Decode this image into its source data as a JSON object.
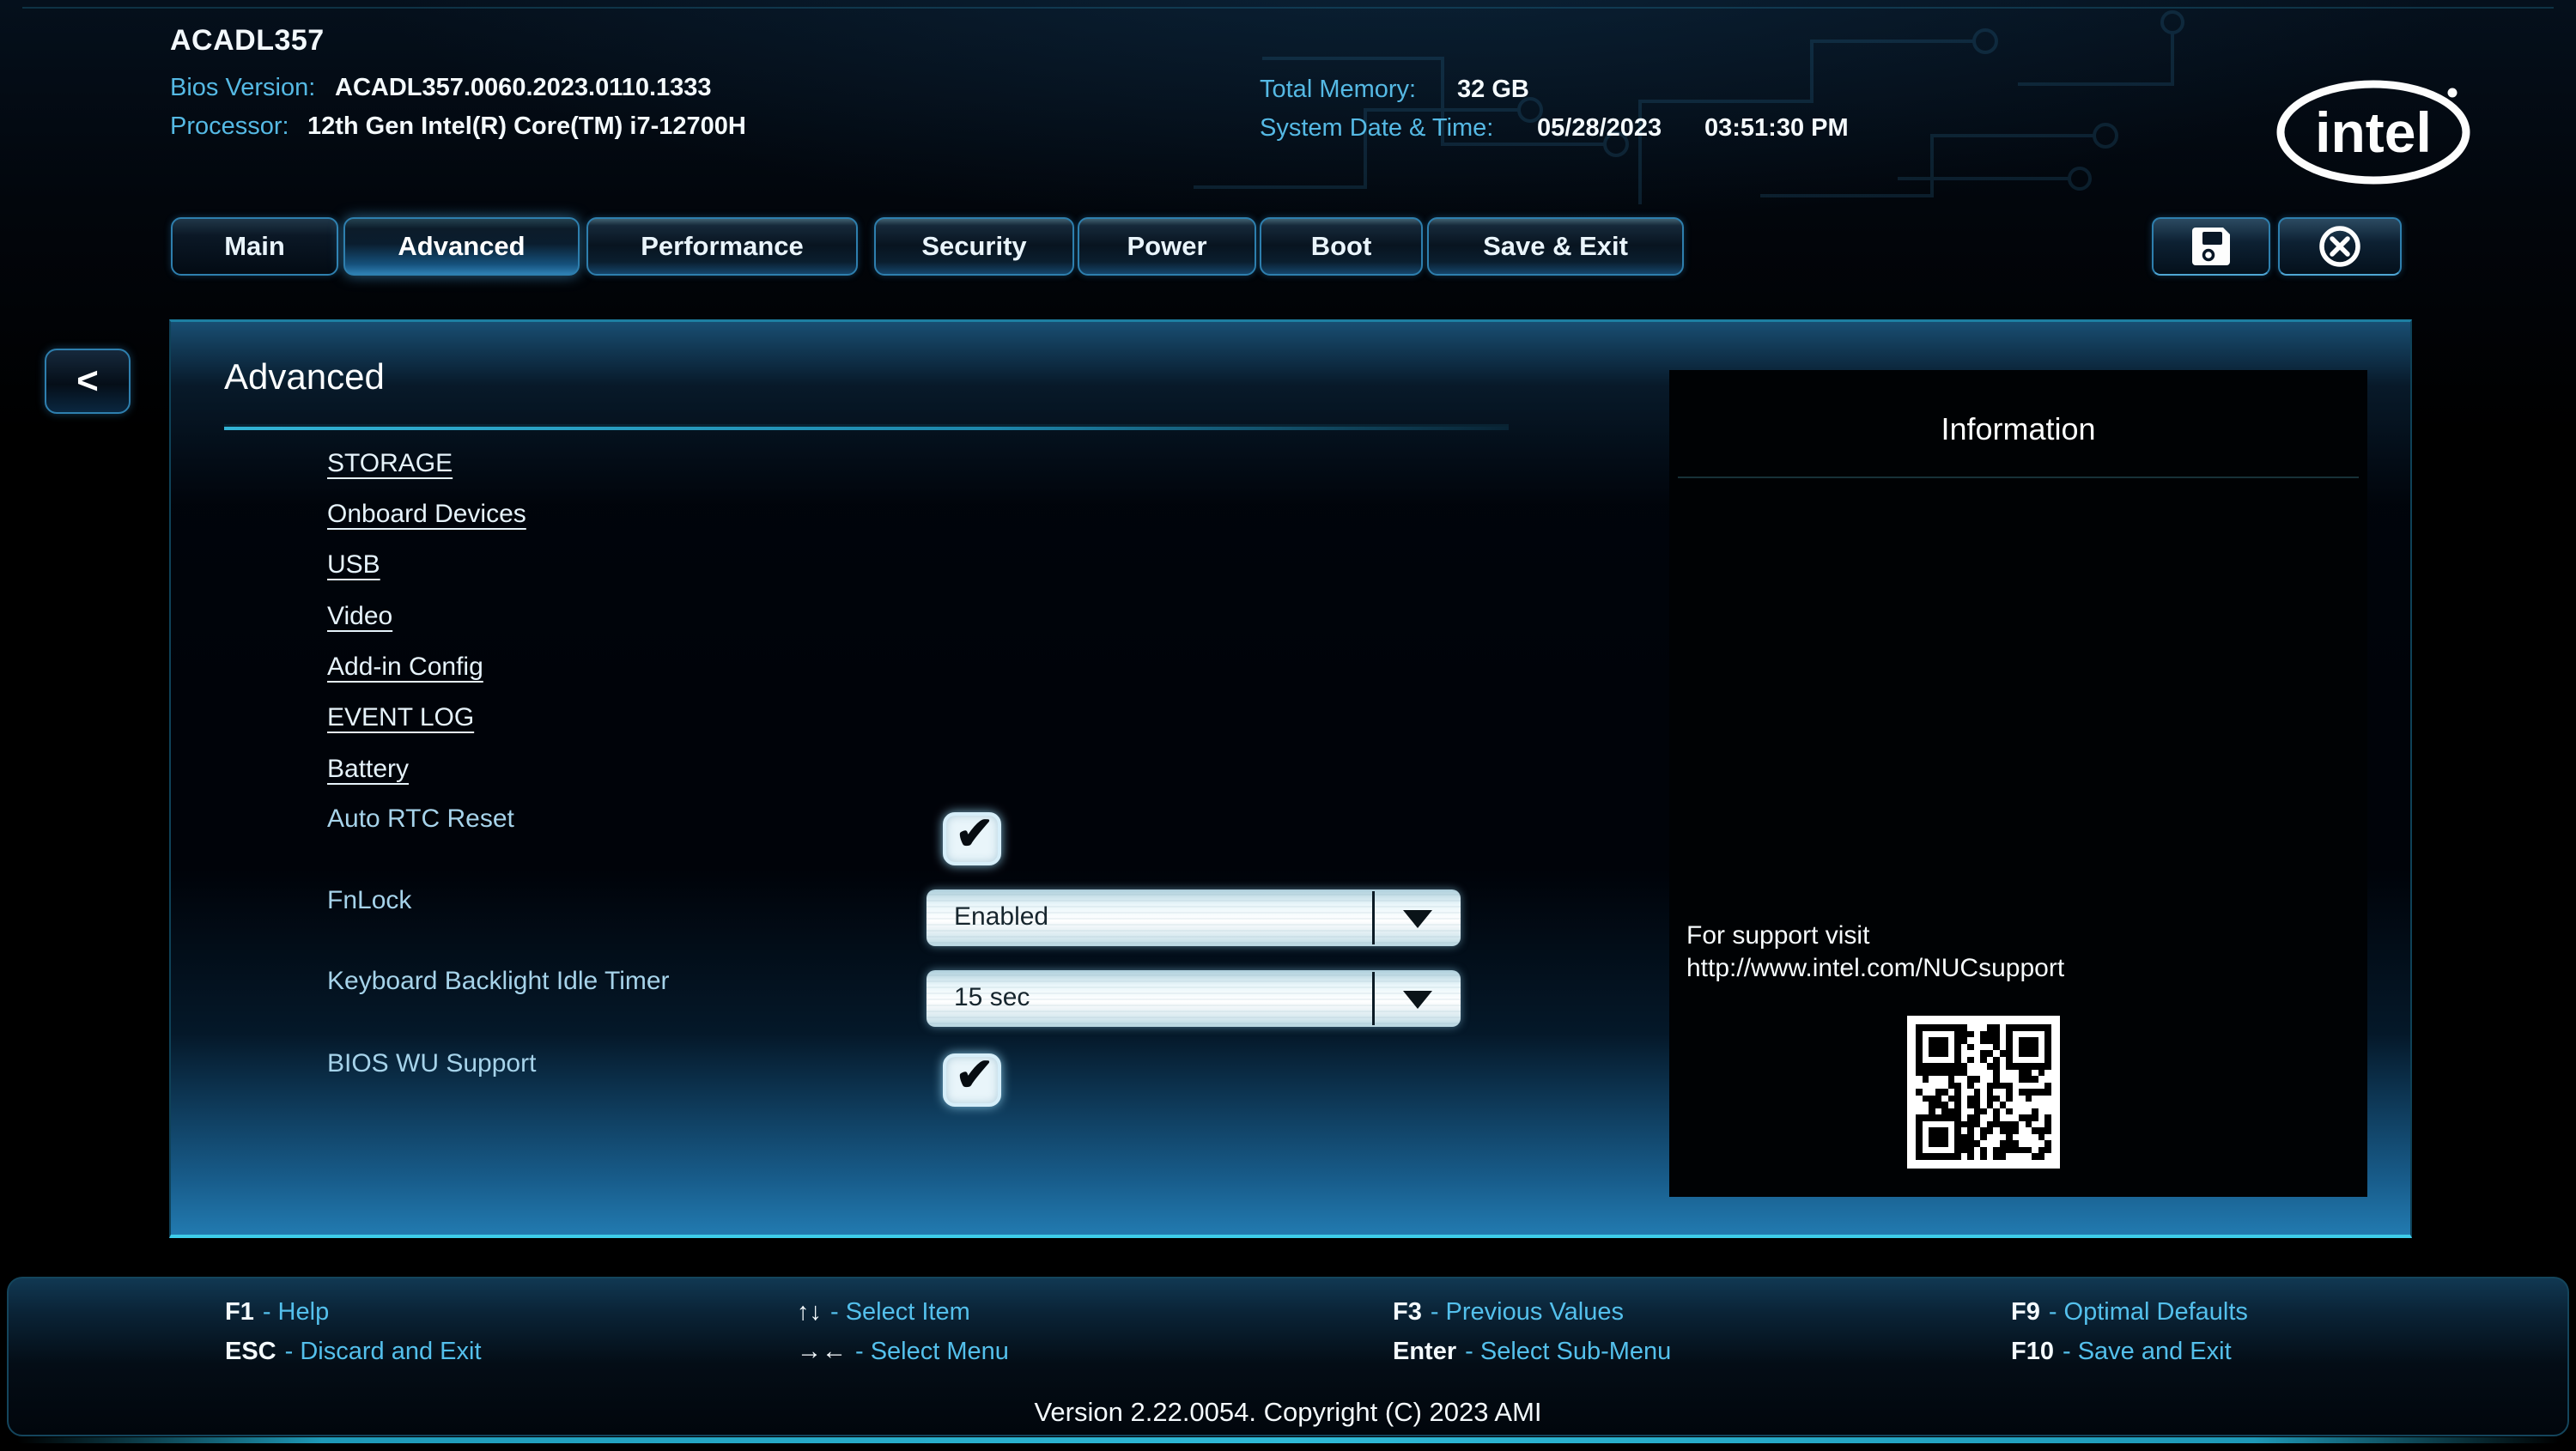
{
  "header": {
    "model": "ACADL357",
    "bios_version_label": "Bios Version:",
    "bios_version": "ACADL357.0060.2023.0110.1333",
    "processor_label": "Processor:",
    "processor": "12th Gen Intel(R) Core(TM) i7-12700H",
    "total_memory_label": "Total Memory:",
    "total_memory": "32 GB",
    "datetime_label": "System Date & Time:",
    "date": "05/28/2023",
    "time": "03:51:30 PM",
    "logo_text": "intel"
  },
  "tabs": [
    {
      "label": "Main",
      "active": false
    },
    {
      "label": "Advanced",
      "active": true
    },
    {
      "label": "Performance",
      "active": false
    },
    {
      "label": "Security",
      "active": false
    },
    {
      "label": "Power",
      "active": false
    },
    {
      "label": "Boot",
      "active": false
    },
    {
      "label": "Save & Exit",
      "active": false
    }
  ],
  "toolbar": {
    "save_icon": "floppy-disk",
    "close_icon": "circle-x"
  },
  "back_button": {
    "label": "<"
  },
  "page": {
    "title": "Advanced",
    "links": [
      "STORAGE",
      "Onboard Devices",
      "USB",
      "Video",
      "Add-in Config",
      "EVENT LOG",
      "Battery"
    ],
    "settings": [
      {
        "label": "Auto RTC Reset",
        "type": "checkbox",
        "checked": true
      },
      {
        "label": "FnLock",
        "type": "dropdown",
        "value": "Enabled"
      },
      {
        "label": "Keyboard Backlight Idle Timer",
        "type": "dropdown",
        "value": "15 sec"
      },
      {
        "label": "BIOS WU Support",
        "type": "checkbox",
        "checked": true
      }
    ]
  },
  "info_panel": {
    "title": "Information",
    "support_line1": "For support visit",
    "support_line2": "http://www.intel.com/NUCsupport"
  },
  "help_bar": {
    "items": [
      {
        "key": "F1",
        "desc": "- Help"
      },
      {
        "key": "ESC",
        "desc": "- Discard and Exit"
      },
      {
        "key": "↑↓",
        "desc": "- Select Item"
      },
      {
        "key": "→←",
        "desc": "- Select Menu"
      },
      {
        "key": "F3",
        "desc": "- Previous Values"
      },
      {
        "key": "Enter",
        "desc": "- Select Sub-Menu"
      },
      {
        "key": "F9",
        "desc": "- Optimal Defaults"
      },
      {
        "key": "F10",
        "desc": "- Save and Exit"
      }
    ]
  },
  "footer": {
    "version": "Version 2.22.0054. Copyright (C) 2023 AMI"
  },
  "icons": {
    "check_glyph": "✔"
  },
  "colors": {
    "accent_cyan": "#35c8e6",
    "label_blue": "#a6d3ea",
    "help_desc_cyan": "#54c0ec",
    "tab_border": "#2e7fae",
    "header_label": "#55b9e4"
  }
}
